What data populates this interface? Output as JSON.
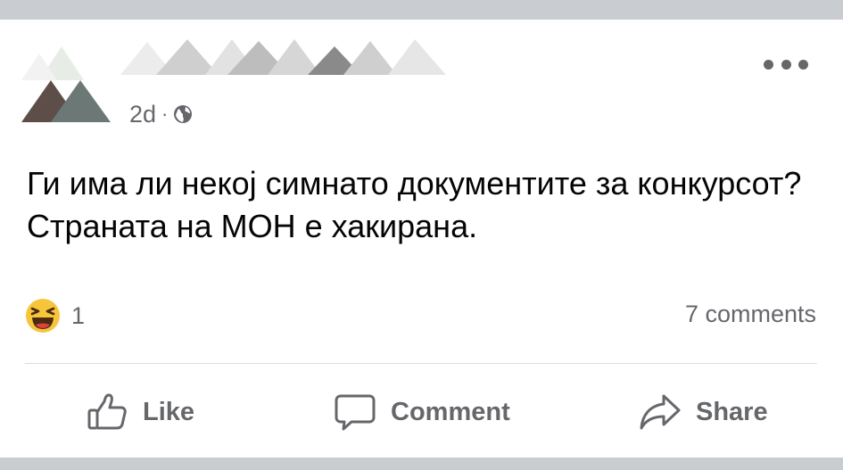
{
  "post": {
    "time": "2d",
    "separator": "·",
    "privacy_icon": "globe-icon",
    "text": "Ги има ли некој симнато документите за конкурсот? Страната на МОН е хакирана.",
    "reaction_icon": "laughing-emoji-icon",
    "reaction_count": "1",
    "comments_count": "7 comments"
  },
  "actions": {
    "like_label": "Like",
    "comment_label": "Comment",
    "share_label": "Share"
  },
  "colors": {
    "background": "#c9ccd1",
    "card": "#ffffff",
    "secondary_text": "#65676b",
    "primary_text": "#050505",
    "divider": "#dadde1"
  }
}
